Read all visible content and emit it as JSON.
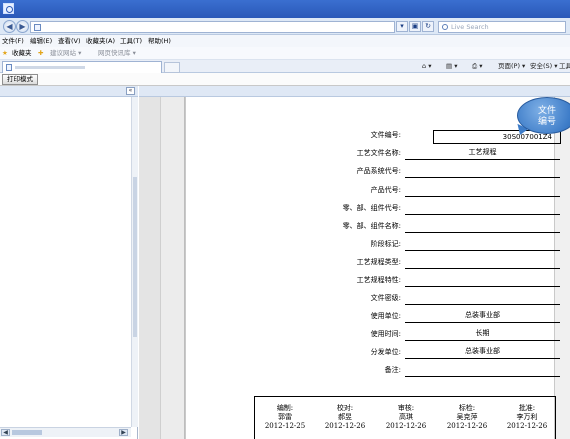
{
  "browser": {
    "search_placeholder": "Live Search",
    "menu": [
      {
        "label": "文件(F)"
      },
      {
        "label": "编辑(E)"
      },
      {
        "label": "查看(V)"
      },
      {
        "label": "收藏夹(A)"
      },
      {
        "label": "工具(T)"
      },
      {
        "label": "帮助(H)"
      }
    ],
    "favorites_label": "收藏夹",
    "favorites_items": [
      {
        "label": "建议网站 ▾"
      },
      {
        "label": "网页快讯库 ▾"
      }
    ],
    "command_bar": {
      "page_label": "页面(P) ▾",
      "safety_label": "安全(S) ▾",
      "tools_label": "工具"
    }
  },
  "toolbar": {
    "print_mode_label": "打印模式"
  },
  "document": {
    "fields": [
      {
        "label": "文件编号:",
        "value": "30S007001Z4"
      },
      {
        "label": "工艺文件名称:",
        "value": "工艺规程"
      },
      {
        "label": "产品系统代号:",
        "value": ""
      },
      {
        "label": "产品代号:",
        "value": ""
      },
      {
        "label": "零、部、组件代号:",
        "value": ""
      },
      {
        "label": "零、部、组件名称:",
        "value": ""
      },
      {
        "label": "阶段标记:",
        "value": ""
      },
      {
        "label": "工艺规程类型:",
        "value": ""
      },
      {
        "label": "工艺规程特性:",
        "value": ""
      },
      {
        "label": "文件密级:",
        "value": ""
      },
      {
        "label": "使用单位:",
        "value": "总装事业部"
      },
      {
        "label": "使用时间:",
        "value": "长期"
      },
      {
        "label": "分发单位:",
        "value": "总装事业部"
      },
      {
        "label": "备注:",
        "value": ""
      }
    ],
    "annotation": {
      "line1": "文件",
      "line2": "编号"
    },
    "signatures": [
      {
        "role": "编制:",
        "name": "郭雷",
        "date": "2012-12-25"
      },
      {
        "role": "校对:",
        "name": "郝昱",
        "date": "2012-12-26"
      },
      {
        "role": "审核:",
        "name": "高琪",
        "date": "2012-12-26"
      },
      {
        "role": "标检:",
        "name": "吴克萍",
        "date": "2012-12-26"
      },
      {
        "role": "批准:",
        "name": "李万利",
        "date": "2012-12-26"
      }
    ]
  },
  "colors": {
    "title_bar": "#2a58b8",
    "annotation_bubble": "#3d7cc8"
  }
}
